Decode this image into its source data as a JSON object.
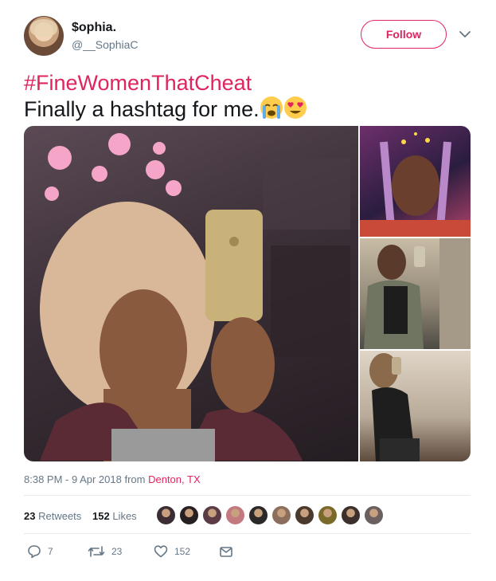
{
  "user": {
    "display_name": "$ophia.",
    "handle": "@__SophiaC",
    "follow_label": "Follow"
  },
  "tweet": {
    "hashtag": "#FineWomenThatCheat",
    "text": "Finally a hashtag for me.",
    "emojis": [
      "crying-face-emoji",
      "heart-eyes-emoji"
    ]
  },
  "media": {
    "count": 4
  },
  "meta": {
    "timestamp": "8:38 PM - 9 Apr 2018 from",
    "location": "Denton, TX"
  },
  "stats": {
    "retweets_count": "23",
    "retweets_label": "Retweets",
    "likes_count": "152",
    "likes_label": "Likes",
    "liker_colors": [
      "#3a2d33",
      "#262022",
      "#5a3b46",
      "#c27a7f",
      "#2b2829",
      "#8b6f5c",
      "#4a3a2e",
      "#7a6a2a",
      "#3b302b",
      "#6b6060"
    ]
  },
  "actions": {
    "reply_count": "7",
    "retweet_count": "23",
    "like_count": "152"
  },
  "colors": {
    "accent": "#e0245e",
    "secondary_text": "#657786"
  }
}
